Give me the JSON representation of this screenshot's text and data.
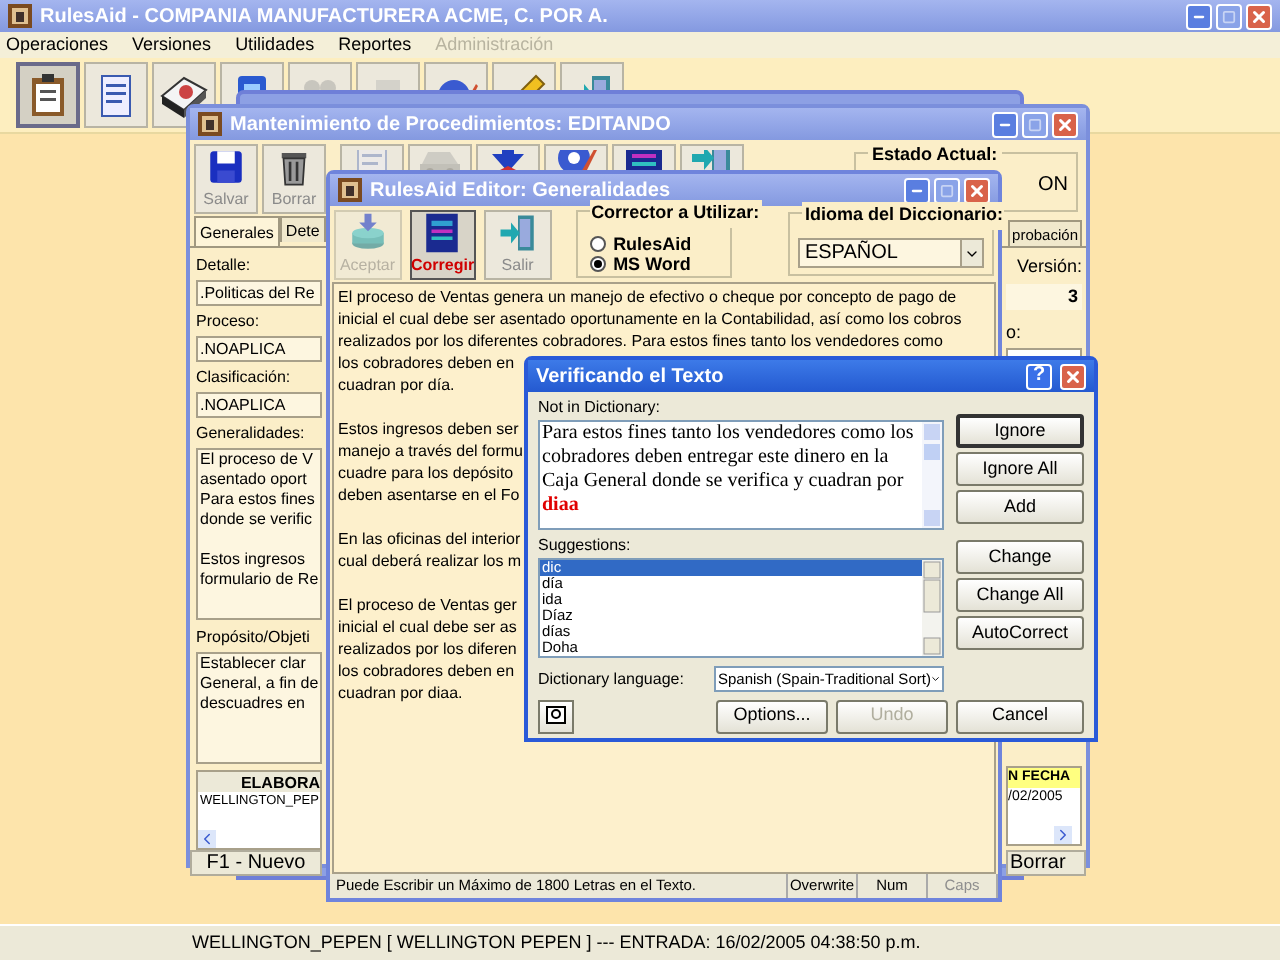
{
  "app": {
    "title": "RulesAid  - COMPANIA MANUFACTURERA ACME, C. POR A."
  },
  "menu": [
    {
      "label": "Operaciones",
      "disabled": false
    },
    {
      "label": "Versiones",
      "disabled": false
    },
    {
      "label": "Utilidades",
      "disabled": false
    },
    {
      "label": "Reportes",
      "disabled": false
    },
    {
      "label": "Administración",
      "disabled": true
    }
  ],
  "toolbar": [
    {
      "pressed": true,
      "disabled": false
    },
    {
      "pressed": false,
      "disabled": false
    },
    {
      "pressed": false,
      "disabled": false
    },
    {
      "pressed": false,
      "disabled": false
    },
    {
      "pressed": false,
      "disabled": true
    },
    {
      "pressed": false,
      "disabled": true
    },
    {
      "pressed": false,
      "disabled": false
    },
    {
      "pressed": false,
      "disabled": false
    },
    {
      "pressed": false,
      "disabled": false
    }
  ],
  "maintenance": {
    "title": "Mantenimiento de Procedimientos: EDITANDO",
    "buttons": [
      {
        "label": "Salvar"
      },
      {
        "label": "Borrar"
      }
    ],
    "status_group": {
      "label": "Estado Actual:",
      "value": "ON"
    },
    "tabs": [
      {
        "label": "Generales",
        "selected": true
      },
      {
        "label": "Dete",
        "selected": false
      },
      {
        "label": "probación",
        "selected": false
      }
    ],
    "fields": [
      {
        "label": "Detalle:",
        "value": ".Politicas del Re"
      },
      {
        "label": "Proceso:",
        "value": ".NOAPLICA"
      },
      {
        "label": "Clasificación:",
        "value": ".NOAPLICA"
      }
    ],
    "generalidades": {
      "label": "Generalidades:",
      "paragraphs": [
        [
          "El proceso de V",
          "asentado oport",
          "Para estos fines",
          "donde se verific"
        ],
        [
          "Estos ingresos",
          "formulario de Re"
        ]
      ]
    },
    "purpose": {
      "label": "Propósito/Objeti",
      "lines": [
        "Establecer clar",
        "General, a fin de",
        "descuadres en"
      ]
    },
    "table_left": {
      "header": "ELABORA",
      "cell": "WELLINGTON_PEP"
    },
    "version": {
      "label": "Versión:",
      "value": "3"
    },
    "right_field": {
      "label": "o:"
    },
    "table_right": {
      "header": "N FECHA",
      "cell": "/02/2005"
    },
    "footer_buttons": [
      {
        "label": "F1 - Nuevo"
      },
      {
        "label": "Borrar"
      }
    ]
  },
  "editor": {
    "title": "RulesAid Editor: Generalidades",
    "buttons": [
      {
        "label": "Aceptar",
        "disabled": true,
        "pressed": false
      },
      {
        "label": "Corregir",
        "disabled": false,
        "pressed": true
      },
      {
        "label": "Salir",
        "disabled": false,
        "pressed": false
      }
    ],
    "checker": {
      "label": "Corrector a Utilizar:",
      "options": [
        {
          "label": "RulesAid",
          "selected": false
        },
        {
          "label": "MS Word",
          "selected": true
        }
      ]
    },
    "language": {
      "label": "Idioma del Diccionario:",
      "value": "ESPAÑOL"
    },
    "paragraphs": [
      [
        "El proceso de Ventas genera un manejo de efectivo o cheque por concepto de pago de",
        "inicial el cual debe ser asentado oportunamente en la Contabilidad, así como los cobros",
        "realizados por los diferentes cobradores. Para estos fines tanto los vendedores como",
        "los cobradores deben en",
        "cuadran por día."
      ],
      [
        "Estos ingresos deben ser",
        "manejo a través del formu",
        "cuadre para los depósito",
        "deben asentarse en el Fo"
      ],
      [
        "En las oficinas del interior",
        "cual deberá realizar los m"
      ],
      [
        "El proceso de Ventas ger",
        "inicial el cual debe ser as",
        "realizados por los diferen",
        "los cobradores deben en",
        "cuadran por diaa."
      ]
    ],
    "status": {
      "message": "Puede Escribir un Máximo de 1800 Letras en el Texto.",
      "panels": [
        {
          "label": "Overwrite",
          "disabled": false
        },
        {
          "label": "Num",
          "disabled": false
        },
        {
          "label": "Caps",
          "disabled": true
        }
      ]
    }
  },
  "dialog": {
    "title": "Verificando el Texto",
    "help_button": "?",
    "not_in_dictionary": {
      "label": "Not in Dictionary:",
      "text": "Para estos fines tanto los vendedores como los cobradores deben entregar este dinero en la Caja General donde se verifica y cuadran por ",
      "flagged": "diaa"
    },
    "suggestions": {
      "label": "Suggestions:",
      "items": [
        {
          "label": "dic",
          "selected": true
        },
        {
          "label": "día",
          "selected": false
        },
        {
          "label": "ida",
          "selected": false
        },
        {
          "label": "Díaz",
          "selected": false
        },
        {
          "label": "días",
          "selected": false
        },
        {
          "label": "Doha",
          "selected": false
        }
      ]
    },
    "language": {
      "label": "Dictionary language:",
      "value": "Spanish (Spain-Traditional Sort)"
    },
    "side_buttons": [
      {
        "label": "Ignore",
        "default": true
      },
      {
        "label": "Ignore All",
        "default": false
      },
      {
        "label": "Add",
        "default": false
      },
      {
        "label": "Change",
        "default": false
      },
      {
        "label": "Change All",
        "default": false
      },
      {
        "label": "AutoCorrect",
        "default": false
      }
    ],
    "bottom_buttons": [
      {
        "label": "Options...",
        "disabled": false
      },
      {
        "label": "Undo",
        "disabled": true
      },
      {
        "label": "Cancel",
        "disabled": false
      }
    ]
  },
  "status_bar": {
    "text": "WELLINGTON_PEPEN [ WELLINGTON PEPEN ] --- ENTRADA: 16/02/2005 04:38:50 p.m."
  }
}
